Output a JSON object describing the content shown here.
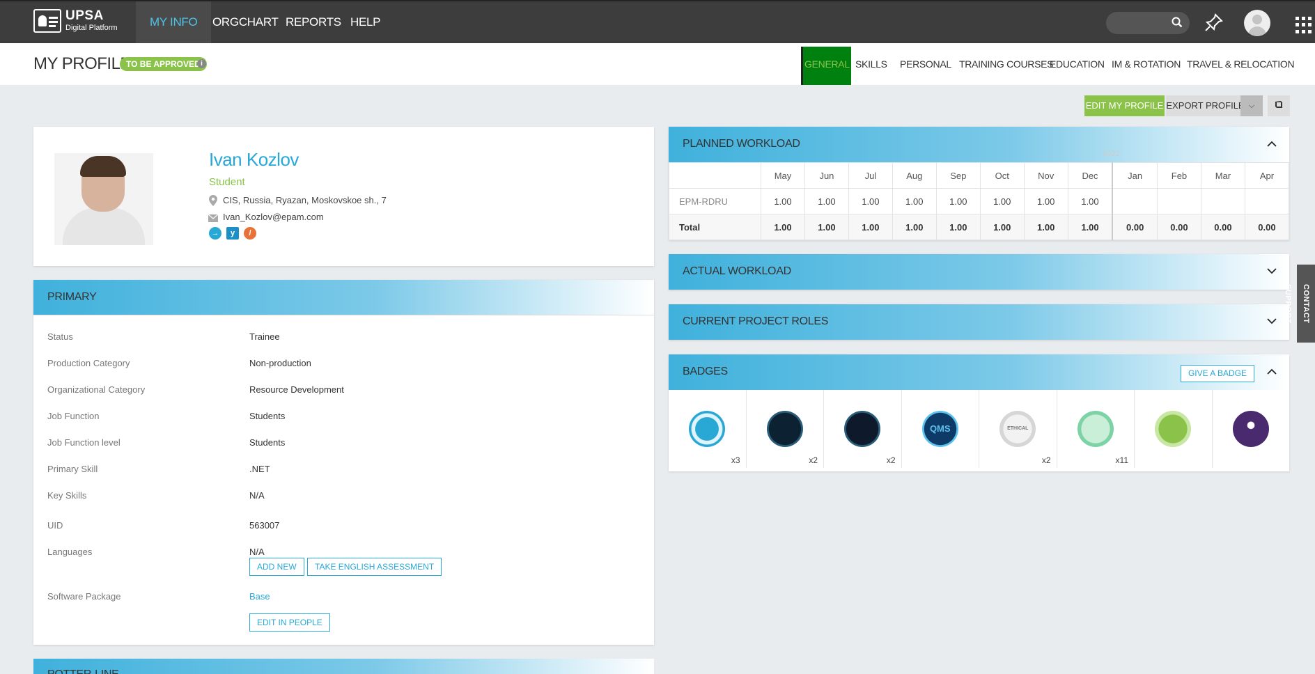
{
  "app": {
    "logo_title": "UPSA",
    "logo_sub": "Digital Platform"
  },
  "nav": {
    "items": [
      {
        "label": "MY INFO"
      },
      {
        "label": "ORGCHART"
      },
      {
        "label": "REPORTS"
      },
      {
        "label": "HELP"
      }
    ]
  },
  "page": {
    "title": "MY PROFILE",
    "status": "TO BE APPROVED",
    "tabs": [
      {
        "label": "GENERAL"
      },
      {
        "label": "SKILLS"
      },
      {
        "label": "PERSONAL"
      },
      {
        "label": "TRAINING COURSES"
      },
      {
        "label": "EDUCATION"
      },
      {
        "label": "IM & ROTATION"
      },
      {
        "label": "TRAVEL & RELOCATION"
      }
    ]
  },
  "actions": {
    "edit": "EDIT MY PROFILE",
    "export": "EXPORT PROFILE"
  },
  "profile": {
    "name": "Ivan Kozlov",
    "title": "Student",
    "location": "CIS, Russia, Ryazan, Moskovskoe sh., 7",
    "email": "Ivan_Kozlov@epam.com"
  },
  "primary": {
    "title": "PRIMARY",
    "rows": [
      {
        "label": "Status",
        "value": "Trainee"
      },
      {
        "label": "Production Category",
        "value": "Non-production"
      },
      {
        "label": "Organizational Category",
        "value": "Resource Development"
      },
      {
        "label": "Job Function",
        "value": "Students"
      },
      {
        "label": "Job Function level",
        "value": "Students"
      },
      {
        "label": "Primary Skill",
        "value": ".NET"
      },
      {
        "label": "Key Skills",
        "value": "N/A"
      },
      {
        "label": "UID",
        "value": "563007"
      },
      {
        "label": "Languages",
        "value": "N/A"
      },
      {
        "label": "Software Package",
        "value": "Base"
      }
    ],
    "add_new": "ADD NEW",
    "take_english": "TAKE ENGLISH ASSESSMENT",
    "edit_in_people": "EDIT IN PEOPLE"
  },
  "potter": {
    "title": "POTTER-LINE"
  },
  "workload": {
    "title": "PLANNED WORKLOAD",
    "year": "2022",
    "months": [
      "May",
      "Jun",
      "Jul",
      "Aug",
      "Sep",
      "Oct",
      "Nov",
      "Dec",
      "Jan",
      "Feb",
      "Mar",
      "Apr"
    ],
    "rows": [
      {
        "name": "EPM-RDRU",
        "values": [
          "1.00",
          "1.00",
          "1.00",
          "1.00",
          "1.00",
          "1.00",
          "1.00",
          "1.00",
          "",
          "",
          "",
          ""
        ]
      },
      {
        "name": "Total",
        "values": [
          "1.00",
          "1.00",
          "1.00",
          "1.00",
          "1.00",
          "1.00",
          "1.00",
          "1.00",
          "0.00",
          "0.00",
          "0.00",
          "0.00"
        ]
      }
    ]
  },
  "actual": {
    "title": "ACTUAL WORKLOAD"
  },
  "roles": {
    "title": "CURRENT PROJECT ROLES"
  },
  "badges": {
    "title": "BADGES",
    "give": "GIVE A BADGE",
    "items": [
      {
        "count": "x3",
        "color": "#29a8d6",
        "ring": "#e0f4fb"
      },
      {
        "count": "x2",
        "color": "#0c2233",
        "ring": "#2a5d7a"
      },
      {
        "count": "x2",
        "color": "#0e1a2b",
        "ring": "#2a5d7a"
      },
      {
        "count": "",
        "color": "#0d3a66",
        "ring": "#5cc2ec",
        "text": "QMS"
      },
      {
        "count": "x2",
        "color": "#d6d6d6",
        "ring": "#efefef",
        "text": "ETHICAL"
      },
      {
        "count": "x11",
        "color": "#7dd3a6",
        "ring": "#c9efd8"
      },
      {
        "count": "",
        "color": "#8bc34a",
        "ring": "#c9e7a4"
      },
      {
        "count": "",
        "color": "#4a2a6e",
        "ring": "#f0a030"
      }
    ]
  },
  "contact": "CONTACT SUPPORT"
}
